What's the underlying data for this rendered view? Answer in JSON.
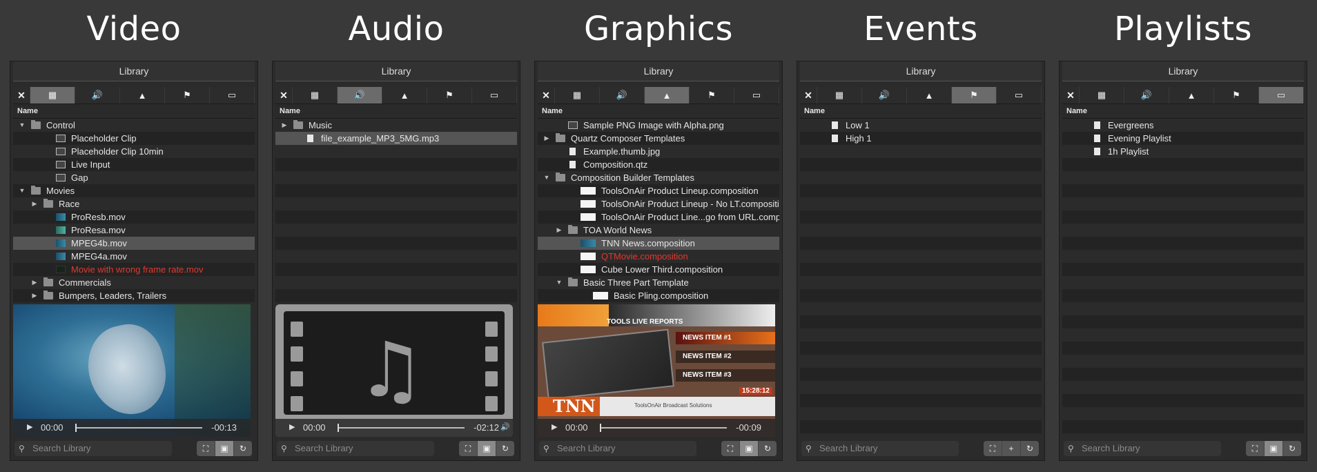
{
  "headings": [
    "Video",
    "Audio",
    "Graphics",
    "Events",
    "Playlists"
  ],
  "panel_title": "Library",
  "tabs": {
    "close_glyph": "✕",
    "icons": [
      "film-icon",
      "speaker-icon",
      "mountain-icon",
      "flag-icon",
      "window-icon"
    ],
    "glyphs": [
      "▦",
      "🔊",
      "▲",
      "⚑",
      "▭"
    ]
  },
  "column_header": "Name",
  "search_placeholder": "Search Library",
  "search_glyph": "⚲",
  "footer_buttons": {
    "default": [
      "⛶",
      "▣",
      "↻"
    ],
    "events": [
      "⛶",
      "+",
      "↻"
    ]
  },
  "video": {
    "selected_tab": 0,
    "rows": [
      {
        "level": 0,
        "disc": "▼",
        "icon": "folder",
        "label": "Control"
      },
      {
        "level": 2,
        "icon": "clip",
        "label": "Placeholder Clip"
      },
      {
        "level": 2,
        "icon": "clip",
        "label": "Placeholder Clip 10min"
      },
      {
        "level": 2,
        "icon": "clip",
        "label": "Live Input"
      },
      {
        "level": 2,
        "icon": "clip",
        "label": "Gap"
      },
      {
        "level": 0,
        "disc": "▼",
        "icon": "folder",
        "label": "Movies"
      },
      {
        "level": 1,
        "disc": "▶",
        "icon": "folder",
        "label": "Race"
      },
      {
        "level": 2,
        "icon": "vid",
        "label": "ProResb.mov"
      },
      {
        "level": 2,
        "icon": "vid2",
        "label": "ProResa.mov"
      },
      {
        "level": 2,
        "icon": "vid",
        "label": "MPEG4b.mov",
        "selected": true
      },
      {
        "level": 2,
        "icon": "vid",
        "label": "MPEG4a.mov"
      },
      {
        "level": 2,
        "icon": "red",
        "label": "Movie with wrong frame rate.mov",
        "error": true
      },
      {
        "level": 1,
        "disc": "▶",
        "icon": "folder",
        "label": "Commercials"
      },
      {
        "level": 1,
        "disc": "▶",
        "icon": "folder",
        "label": "Bumpers, Leaders, Trailers"
      }
    ],
    "player": {
      "play": "▶",
      "current": "00:00",
      "remaining": "-00:13"
    }
  },
  "audio": {
    "selected_tab": 1,
    "rows": [
      {
        "level": 0,
        "disc": "▶",
        "icon": "folder",
        "label": "Music"
      },
      {
        "level": 1,
        "icon": "doc",
        "label": "file_example_MP3_5MG.mp3",
        "selected": true
      }
    ],
    "player": {
      "play": "▶",
      "current": "00:00",
      "remaining": "-02:12",
      "volume": "🔊"
    }
  },
  "graphics": {
    "selected_tab": 2,
    "rows": [
      {
        "level": 1,
        "icon": "clip",
        "label": "Sample PNG Image with Alpha.png"
      },
      {
        "level": 0,
        "disc": "▶",
        "icon": "folder",
        "label": "Quartz Composer Templates"
      },
      {
        "level": 1,
        "icon": "doc",
        "label": "Example.thumb.jpg"
      },
      {
        "level": 1,
        "icon": "doc",
        "label": "Composition.qtz"
      },
      {
        "level": 0,
        "disc": "▼",
        "icon": "folder",
        "label": "Composition Builder Templates"
      },
      {
        "level": 2,
        "icon": "white",
        "label": "ToolsOnAir Product Lineup.composition"
      },
      {
        "level": 2,
        "icon": "white",
        "label": "ToolsOnAir Product Lineup - No LT.composition"
      },
      {
        "level": 2,
        "icon": "white",
        "label": "ToolsOnAir Product Line...go from URL.composition"
      },
      {
        "level": 1,
        "disc": "▶",
        "icon": "folder",
        "label": "TOA World News"
      },
      {
        "level": 2,
        "icon": "tnn",
        "label": "TNN News.composition",
        "selected": true
      },
      {
        "level": 2,
        "icon": "white",
        "label": "QTMovie.composition",
        "error": true
      },
      {
        "level": 2,
        "icon": "white",
        "label": "Cube Lower Third.composition"
      },
      {
        "level": 1,
        "disc": "▼",
        "icon": "folder",
        "label": "Basic Three Part Template"
      },
      {
        "level": 3,
        "icon": "white",
        "label": "Basic Pling.composition"
      }
    ],
    "preview": {
      "top_label": "TOOLS LIVE REPORTS",
      "items": [
        "NEWS ITEM #1",
        "NEWS ITEM #2",
        "NEWS ITEM #3"
      ],
      "time": "15:28:12",
      "logo": "TNN",
      "ticker": "ToolsOnAir Broadcast Solutions"
    },
    "player": {
      "play": "▶",
      "current": "00:00",
      "remaining": "-00:09"
    }
  },
  "events": {
    "selected_tab": 3,
    "rows": [
      {
        "level": 1,
        "icon": "doc",
        "label": "Low 1"
      },
      {
        "level": 1,
        "icon": "doc",
        "label": "High 1"
      }
    ]
  },
  "playlists": {
    "selected_tab": 4,
    "rows": [
      {
        "level": 1,
        "icon": "doc",
        "label": "Evergreens"
      },
      {
        "level": 1,
        "icon": "doc",
        "label": "Evening Playlist"
      },
      {
        "level": 1,
        "icon": "doc",
        "label": "1h Playlist"
      }
    ]
  },
  "colors": {
    "background": "#393939",
    "selection": "#555555",
    "error": "#e0392f",
    "tab_selected": "#6b6b6b"
  }
}
